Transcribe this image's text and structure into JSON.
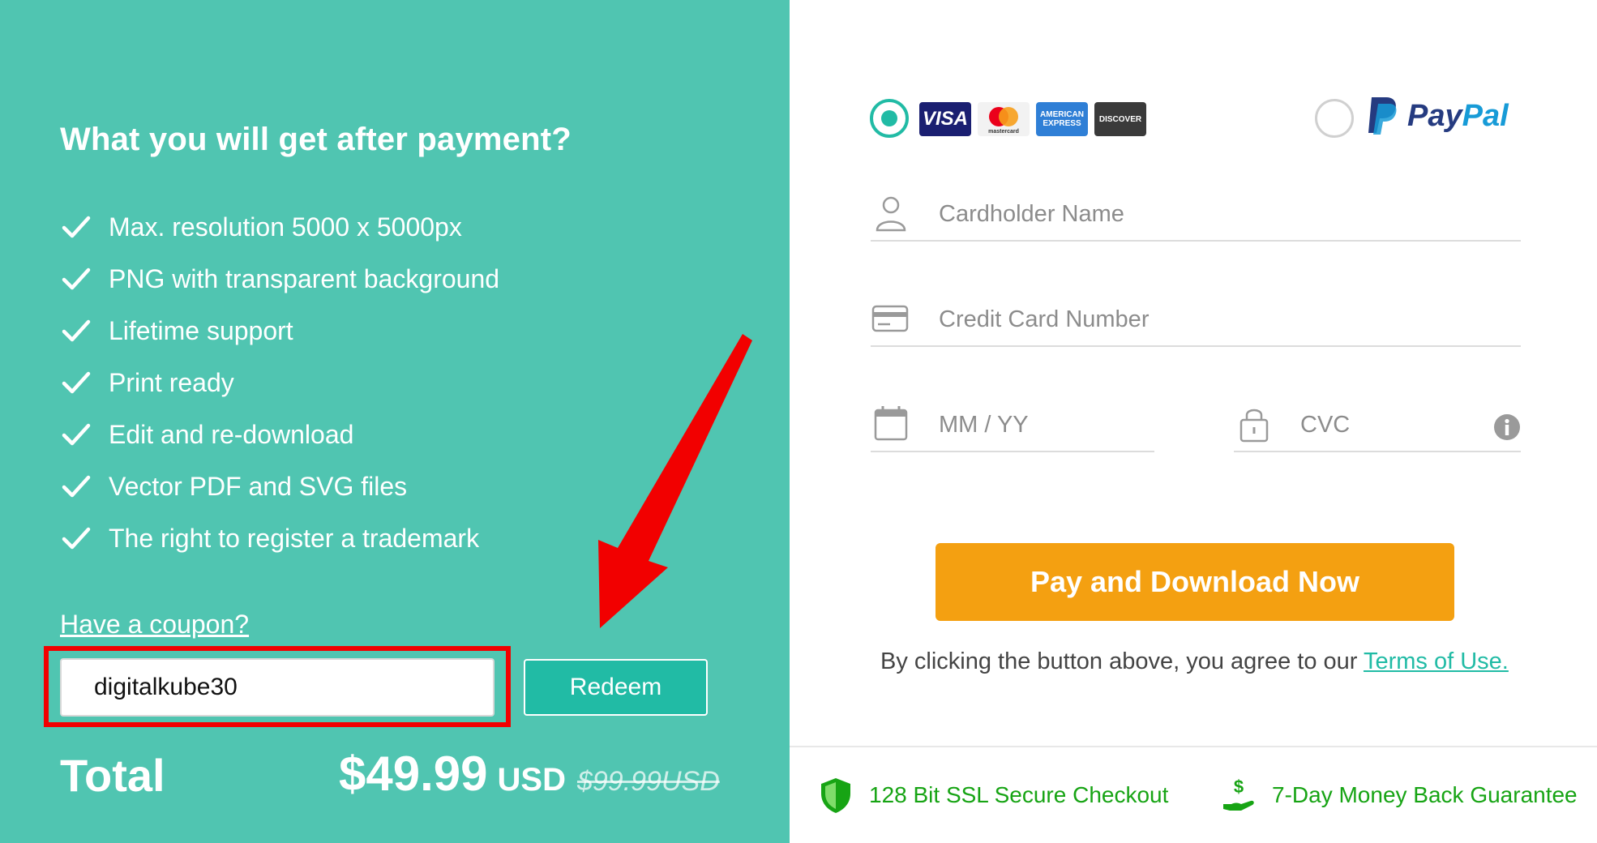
{
  "left": {
    "title": "What you will get after payment?",
    "features": [
      "Max. resolution 5000 x 5000px",
      "PNG with transparent background",
      "Lifetime support",
      "Print ready",
      "Edit and re-download",
      "Vector PDF and SVG files",
      "The right to register a trademark"
    ],
    "coupon_link": "Have a coupon?",
    "coupon_value": "digitalkube30",
    "redeem_label": "Redeem",
    "total_label": "Total",
    "price": "$49.99",
    "currency": "USD",
    "old_price": "$99.99USD"
  },
  "payment": {
    "selected_method": "card",
    "card_brands": [
      "VISA",
      "mastercard",
      "AMERICAN EXPRESS",
      "DISCOVER"
    ],
    "paypal": {
      "pay": "Pay",
      "pal": "Pal"
    }
  },
  "form": {
    "cardholder_placeholder": "Cardholder Name",
    "card_number_placeholder": "Credit Card Number",
    "expiry_placeholder": "MM / YY",
    "cvc_placeholder": "CVC"
  },
  "actions": {
    "pay_button": "Pay and Download Now",
    "agree_text": "By clicking the button above, you agree to our",
    "terms_link": "Terms of Use."
  },
  "trust": {
    "ssl": "128 Bit SSL Secure Checkout",
    "money_back": "7-Day Money Back Guarantee"
  },
  "colors": {
    "left_bg": "#50c5b1",
    "accent_teal": "#21bba5",
    "pay_button": "#f4a011",
    "trust_green": "#17a414",
    "highlight_red": "#f20000"
  }
}
